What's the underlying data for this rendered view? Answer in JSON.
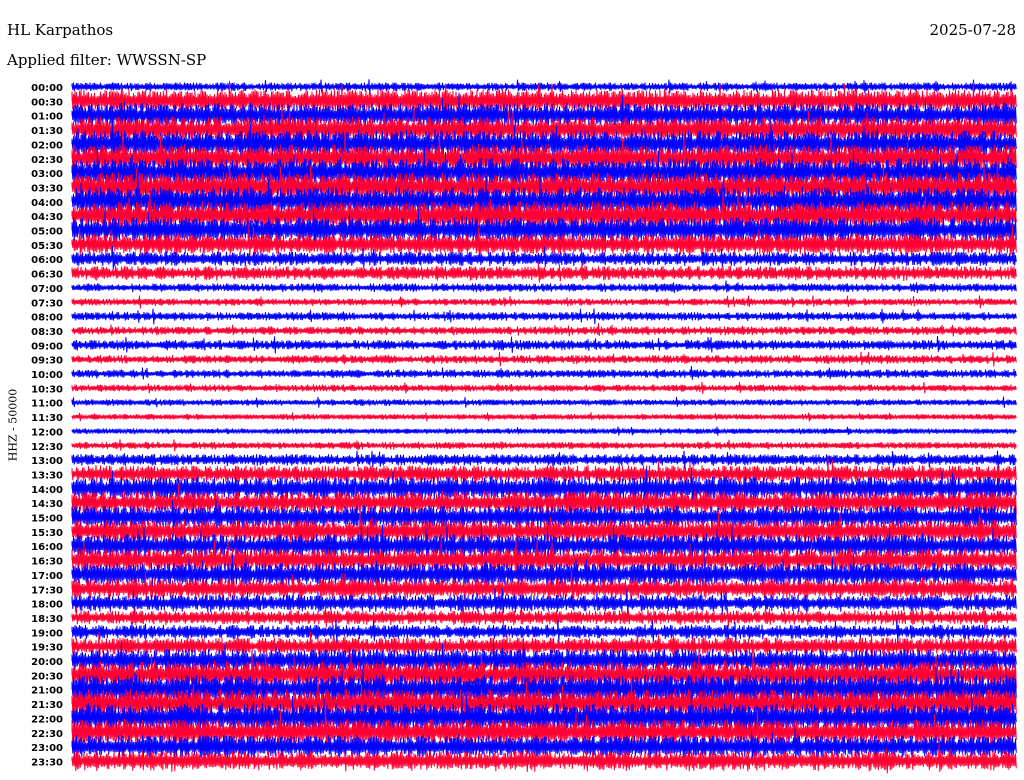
{
  "header": {
    "station": "HL Karpathos",
    "date": "2025-07-28",
    "filter": "Applied filter: WWSSN-SP"
  },
  "chart_data": {
    "type": "line",
    "title": "HL Karpathos",
    "subtitle": "Applied filter: WWSSN-SP",
    "ylabel": "HHZ - 50000",
    "xlabel": "",
    "series_colors": [
      "#0000ff",
      "#ff0033"
    ],
    "rows": [
      "00:00",
      "00:30",
      "01:00",
      "01:30",
      "02:00",
      "02:30",
      "03:00",
      "03:30",
      "04:00",
      "04:30",
      "05:00",
      "05:30",
      "06:00",
      "06:30",
      "07:00",
      "07:30",
      "08:00",
      "08:30",
      "09:00",
      "09:30",
      "10:00",
      "10:30",
      "11:00",
      "11:30",
      "12:00",
      "12:30",
      "13:00",
      "13:30",
      "14:00",
      "14:30",
      "15:00",
      "15:30",
      "16:00",
      "16:30",
      "17:00",
      "17:30",
      "18:00",
      "18:30",
      "19:00",
      "19:30",
      "20:00",
      "20:30",
      "21:00",
      "21:30",
      "22:00",
      "22:30",
      "23:00",
      "23:30"
    ],
    "row_activity": [
      0.6,
      1.6,
      1.7,
      1.8,
      1.9,
      1.9,
      2.0,
      2.0,
      2.0,
      2.0,
      1.8,
      1.5,
      1.0,
      1.0,
      0.6,
      0.5,
      0.6,
      0.6,
      0.7,
      0.6,
      0.6,
      0.5,
      0.45,
      0.4,
      0.4,
      0.5,
      0.8,
      1.2,
      1.6,
      1.6,
      1.6,
      1.6,
      1.6,
      1.6,
      1.6,
      1.4,
      1.2,
      1.0,
      1.0,
      1.2,
      1.6,
      1.9,
      2.0,
      2.0,
      2.0,
      1.8,
      1.6,
      1.4
    ],
    "grid": false,
    "legend": "none"
  }
}
